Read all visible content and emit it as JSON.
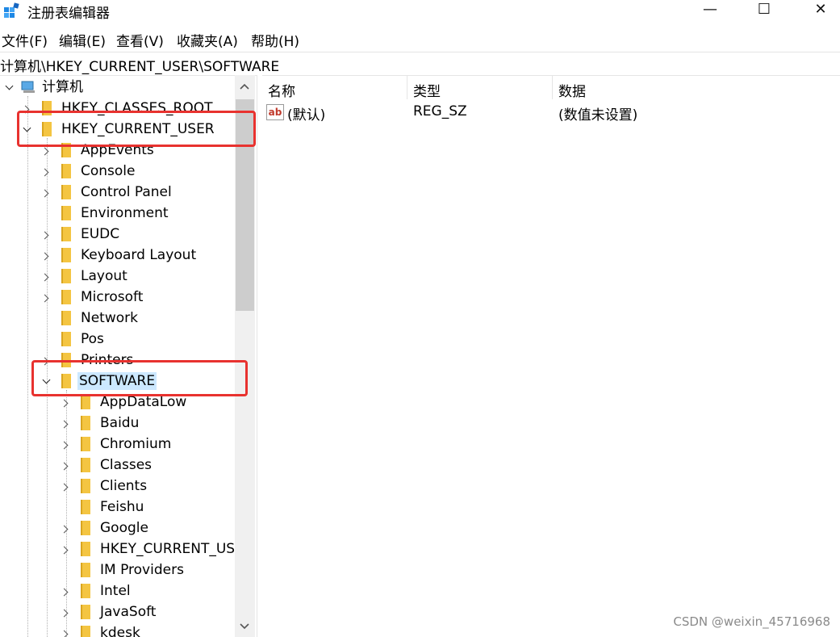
{
  "window": {
    "title": "注册表编辑器",
    "minimize_glyph": "—",
    "maximize_glyph": "☐",
    "close_glyph": "✕"
  },
  "menu": [
    "文件(F)",
    "编辑(E)",
    "查看(V)",
    "收藏夹(A)",
    "帮助(H)"
  ],
  "address": "计算机\\HKEY_CURRENT_USER\\SOFTWARE",
  "tree": {
    "root_label": "计算机",
    "hkcr_label": "HKEY_CLASSES_ROOT",
    "hkcu_label": "HKEY_CURRENT_USER",
    "hkcu_children": [
      "AppEvents",
      "Console",
      "Control Panel",
      "Environment",
      "EUDC",
      "Keyboard Layout",
      "Layout",
      "Microsoft",
      "Network",
      "Pos",
      "Printers",
      "SOFTWARE"
    ],
    "software_children": [
      "AppDataLow",
      "Baidu",
      "Chromium",
      "Classes",
      "Clients",
      "Feishu",
      "Google",
      "HKEY_CURRENT_USER",
      "IM Providers",
      "Intel",
      "JavaSoft",
      "kdesk"
    ]
  },
  "values_pane": {
    "columns": [
      "名称",
      "类型",
      "数据"
    ],
    "rows": [
      {
        "name": "(默认)",
        "type": "REG_SZ",
        "data": "(数值未设置)"
      }
    ]
  },
  "watermark": "CSDN @weixin_45716968",
  "highlight_color": "#e8322f",
  "selection_color": "#cce8ff"
}
